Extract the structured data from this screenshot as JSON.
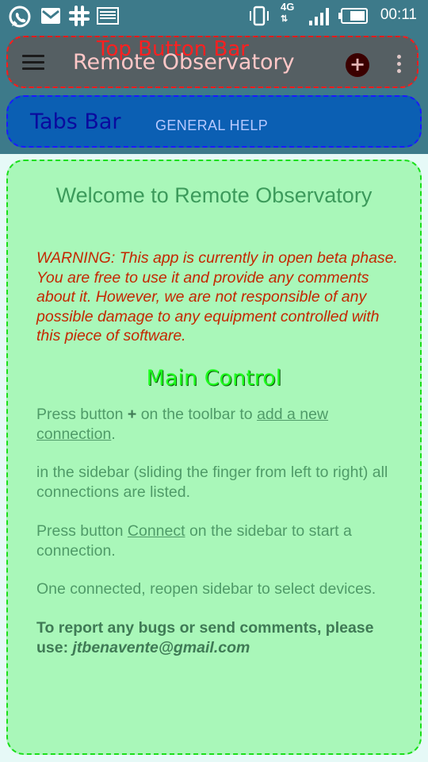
{
  "status_bar": {
    "time": "00:11",
    "network": "4G",
    "icons": [
      "whatsapp-icon",
      "email-icon",
      "slack-icon",
      "gallery-icon",
      "vibrate-icon",
      "signal-icon",
      "battery-icon"
    ]
  },
  "app_bar": {
    "annotation_label": "Top Button Bar",
    "title": "Remote Observatory",
    "add_button_glyph": "+",
    "menu_icon": "hamburger-icon",
    "overflow_icon": "more-vert-icon"
  },
  "tabs": {
    "annotation_label": "Tabs Bar",
    "items": [
      {
        "label": "GENERAL HELP"
      }
    ]
  },
  "content": {
    "title": "Welcome to Remote Observatory",
    "warning": "WARNING: This app is currently in open beta phase. You are free to use it and provide any comments about it. However, we are not responsible of any possible damage to any equipment controlled with this piece of software.",
    "section_title": "Main Control",
    "p1_prefix": "Press button ",
    "p1_plus": "+",
    "p1_middle": " on the toolbar to ",
    "p1_link": "add a new connection",
    "p1_suffix": ".",
    "p2": "in the sidebar (sliding the finger from left to right) all connections are listed.",
    "p3_prefix": "Press button ",
    "p3_link": "Connect",
    "p3_suffix": " on the sidebar to start a connection.",
    "p4": "One connected, reopen sidebar to select devices.",
    "p5_text": "To report any bugs or send comments, please use: ",
    "p5_email": "jtbenavente@gmail.com"
  },
  "colors": {
    "status_bar_bg": "#3d7a8a",
    "top_bar_bg": "#555f63",
    "tabs_bar_bg": "#0b5fb3",
    "content_bg": "#a9f7b9",
    "warning_text": "#c42800",
    "main_control_text": "#1dff1d"
  }
}
